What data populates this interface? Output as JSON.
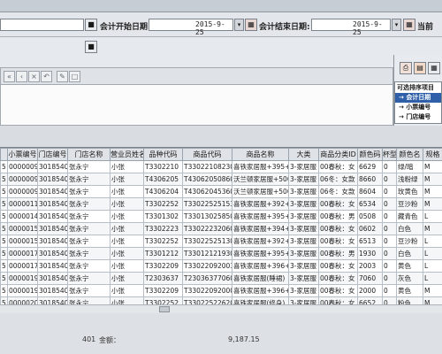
{
  "header": {
    "start_date_label": "会计开始日期:",
    "start_date_value": "2015-9-25",
    "end_date_label": "会计结束日期:",
    "end_date_value": "2015-9-25",
    "current_label": "当前"
  },
  "sort_panel": {
    "title": "可选排序项目",
    "items": [
      "会计日期",
      "小票编号",
      "门店编号"
    ],
    "selected_index": 0
  },
  "grid": {
    "columns": [
      "",
      "小票编号",
      "门店编号",
      "门店名称",
      "营业员姓名",
      "品种代码",
      "商品代码",
      "商品名称",
      "大类",
      "商品分类ID",
      "颜色码",
      "杯型",
      "颜色名",
      "规格"
    ],
    "rows": [
      [
        "5",
        "00000093",
        "3018540",
        "张永宁",
        "小张",
        "T3302210",
        "T330221082304",
        "喜铁家居服+395+5",
        "3-家居服",
        "00春秋：女",
        "6629",
        "0",
        "绿/暗",
        "M"
      ],
      [
        "5",
        "00000095",
        "3018540",
        "张永宁",
        "小张",
        "T4306205",
        "T430620508603",
        "沃兰顿家居服+500+5",
        "3-家居服",
        "06冬：女款",
        "8660",
        "0",
        "浅粉绿",
        "M"
      ],
      [
        "5",
        "00000095",
        "3018540",
        "张永宁",
        "小张",
        "T4306204",
        "T430620453604",
        "沃兰顿家居服+500+5",
        "3-家居服",
        "06冬：女款",
        "8604",
        "0",
        "玫黄色",
        "M"
      ],
      [
        "5",
        "00000116",
        "3018540",
        "张永宁",
        "小张",
        "T3302252",
        "T330225251534",
        "喜铁家居服+392+5",
        "3-家居服",
        "00春秋：女",
        "6534",
        "0",
        "豆沙粉",
        "M"
      ],
      [
        "5",
        "00000143",
        "3018540",
        "张永宁",
        "小张",
        "T3301302",
        "T330130258504",
        "喜铁家居服+395+5",
        "3-家居服",
        "00春秋：男",
        "0508",
        "0",
        "藏青色",
        "L"
      ],
      [
        "5",
        "00000152",
        "3018540",
        "张永宁",
        "小张",
        "T3302223",
        "T330222320602",
        "喜铁家居服+394+5",
        "3-家居服",
        "00春秋：女",
        "0602",
        "0",
        "白色",
        "M"
      ],
      [
        "5",
        "00000152",
        "3018540",
        "张永宁",
        "小张",
        "T3302252",
        "T330225251303",
        "喜铁家居服+392+5",
        "3-家居服",
        "00春秋：女",
        "6513",
        "0",
        "豆沙粉",
        "L"
      ],
      [
        "5",
        "00000170",
        "3018540",
        "张永宁",
        "小张",
        "T3301212",
        "T330121219303",
        "喜铁家居服+395+5",
        "3-家居服",
        "00春秋：男",
        "1930",
        "0",
        "白色",
        "L"
      ],
      [
        "5",
        "00000170",
        "3018540",
        "张永宁",
        "小张",
        "T3302209",
        "T330220920032",
        "喜铁家居服+396+5",
        "3-家居服",
        "00春秋：女",
        "2003",
        "0",
        "黄色",
        "L"
      ],
      [
        "5",
        "00000190",
        "3018540",
        "张永宁",
        "小张",
        "T2303637",
        "T230363770605",
        "喜铁家居服(睡裙)",
        "3-家居服",
        "00春秋：女",
        "7060",
        "0",
        "灰色",
        "L"
      ],
      [
        "5",
        "00000197",
        "3018540",
        "张永宁",
        "小张",
        "T3302209",
        "T330220920002",
        "喜铁家居服+396+5",
        "3-家居服",
        "00春秋：女",
        "2000",
        "0",
        "黄色",
        "M"
      ],
      [
        "5",
        "00000201",
        "3018540",
        "张永宁",
        "小张",
        "T3302252",
        "T330225226202",
        "喜铁家居服(修身)",
        "3-家居服",
        "00春秋：女",
        "6652",
        "0",
        "粉色",
        "M"
      ]
    ]
  },
  "status": {
    "count": "401",
    "amount_label": "金额：",
    "amount_value": "9,187.15"
  }
}
